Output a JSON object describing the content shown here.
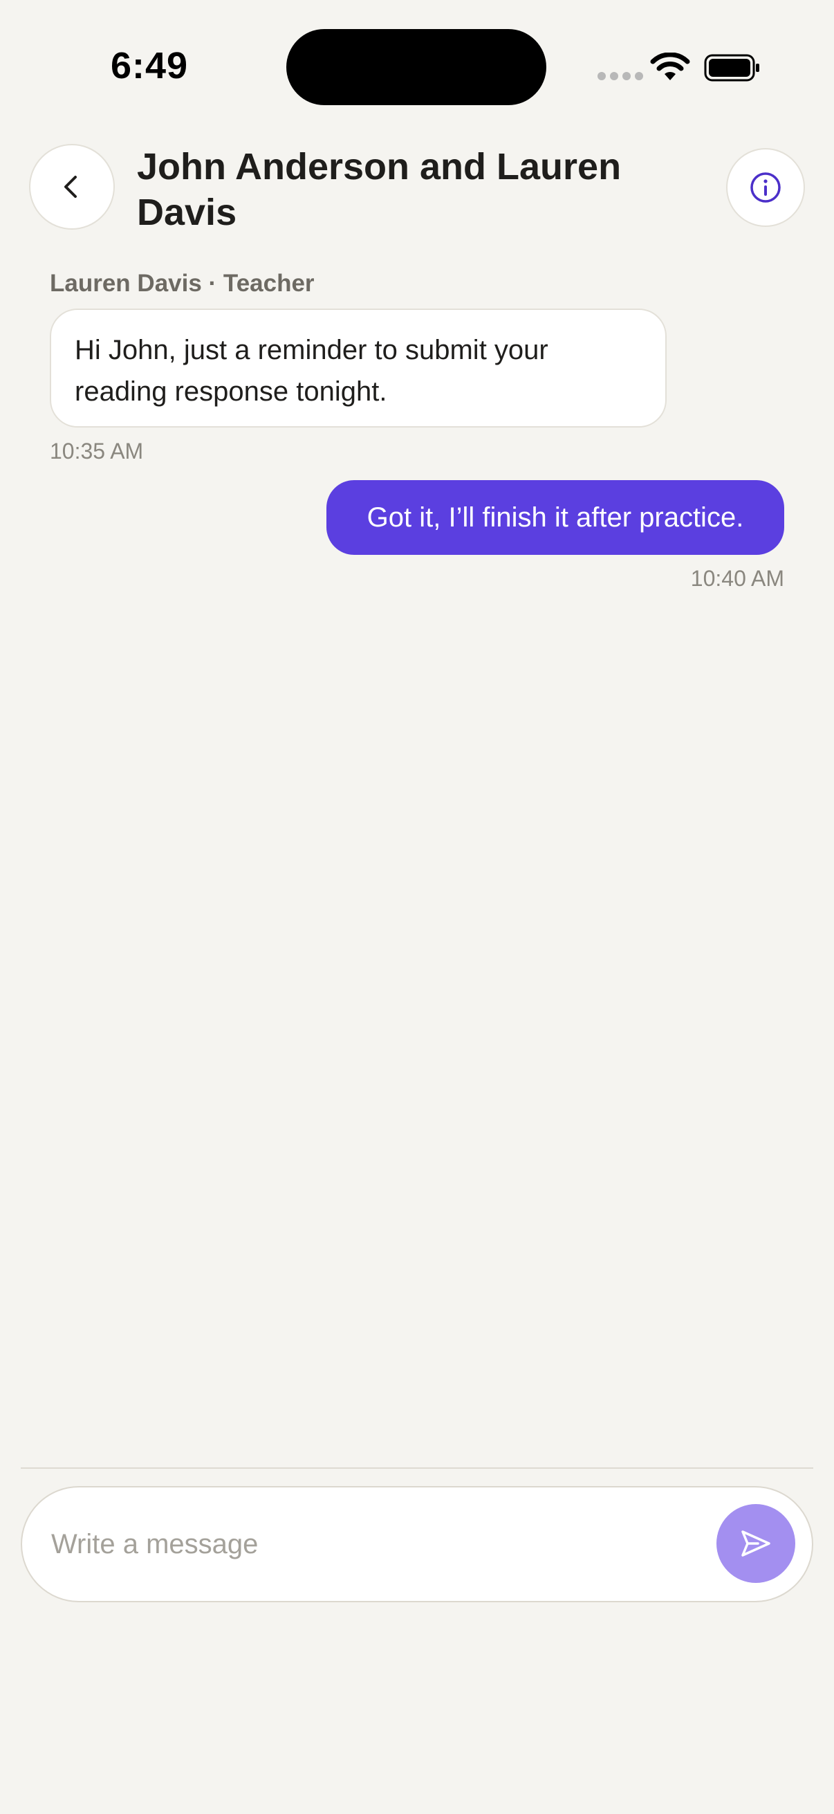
{
  "status_bar": {
    "time": "6:49"
  },
  "header": {
    "title": "John Anderson and Lauren Davis",
    "back_icon": "chevron-left-icon",
    "info_icon": "info-circle-icon"
  },
  "messages": [
    {
      "direction": "incoming",
      "sender": "Lauren Davis · Teacher",
      "text": "Hi John, just a reminder to submit your reading response tonight.",
      "time": "10:35 AM"
    },
    {
      "direction": "outgoing",
      "text": "Got it, I’ll finish it after practice.",
      "time": "10:40 AM"
    }
  ],
  "composer": {
    "placeholder": "Write a message",
    "value": "",
    "send_icon": "send-icon"
  },
  "colors": {
    "background": "#f5f4f0",
    "accent": "#5b3fe0",
    "send_button_disabled": "#a38ff0",
    "info_icon": "#4b2fc9"
  }
}
